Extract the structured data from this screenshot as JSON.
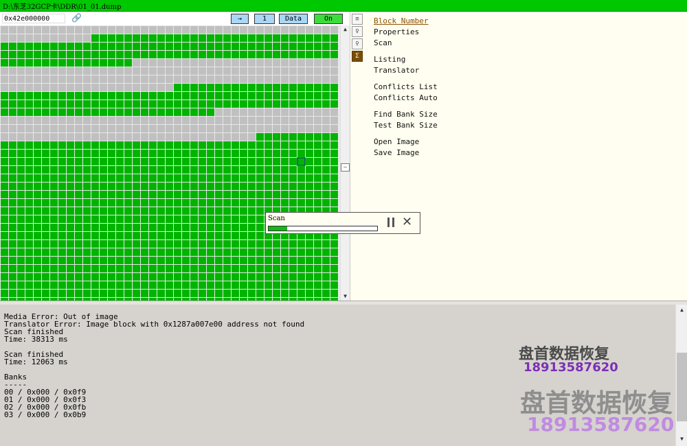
{
  "window": {
    "title": "D:\\东芝32GCP卡\\DDR\\01_01.dump"
  },
  "toolbar": {
    "address_value": "0x42e000000",
    "link_icon": "chain-link-icon",
    "arrow_label": "→",
    "page_label": "1",
    "data_label": "Data",
    "on_label": "On"
  },
  "block_map": {
    "status_colors": {
      "good": "#00b400",
      "empty": "#c0c0c0",
      "current_outline": "#1e3a8a"
    },
    "gray_cells": "first 9 rows of 9, 10, 10, 10, 10, 10, 10, 10 and 10 cells are partially grey; remaining rows green"
  },
  "iconbar": {
    "icons": [
      "settings-icon",
      "pin-icon",
      "pin-icon",
      "map-icon"
    ]
  },
  "menu": {
    "items": [
      "Block Number",
      "Properties",
      "Scan",
      "Listing",
      "Translator",
      "Conflicts List",
      "Conflicts Auto",
      "Find Bank Size",
      "Test Bank Size",
      "Open Image",
      "Save Image"
    ],
    "selected": "Block Number"
  },
  "scan_dialog": {
    "title": "Scan",
    "progress": 0.17
  },
  "log": {
    "lines": [
      "Media Error: Out of image",
      "Translator Error: Image block with 0x1287a007e00 address not found",
      "Scan finished",
      "Time: 38313 ms",
      "",
      "Scan finished",
      "Time: 12063 ms",
      "",
      "Banks",
      "-----",
      "00 / 0x000 / 0x0f9",
      "01 / 0x000 / 0x0f3",
      "02 / 0x000 / 0x0fb",
      "03 / 0x000 / 0x0b9"
    ]
  },
  "watermark": {
    "name_small": "盘首数据恢复",
    "phone_small": "18913587620",
    "name_large": "盘首数据恢复",
    "phone_large": "18913587620"
  }
}
